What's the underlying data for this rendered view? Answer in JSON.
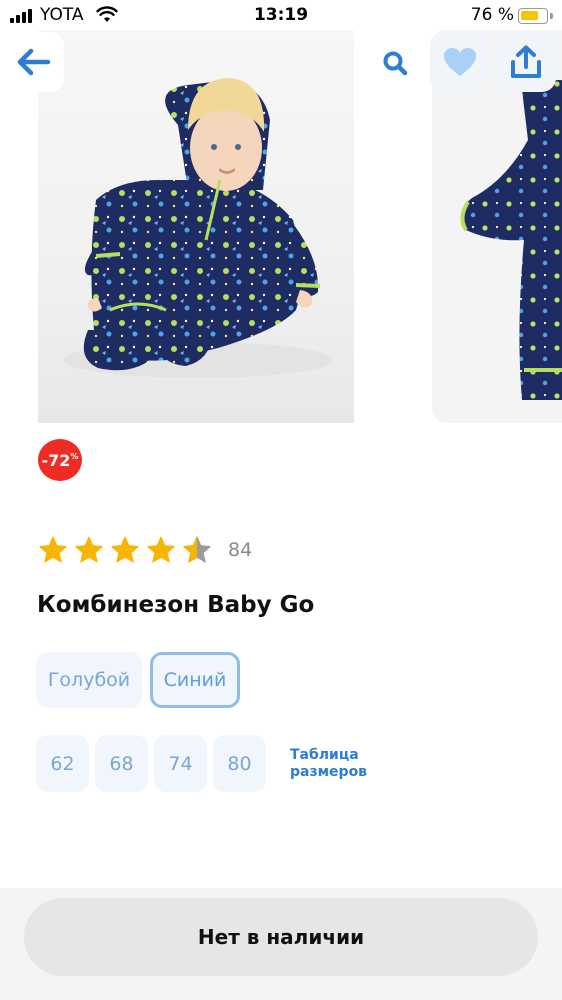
{
  "status_bar": {
    "carrier": "YOTA",
    "time": "13:19",
    "battery_percent": "76 %",
    "battery_level": 0.76
  },
  "gallery": {
    "icons": {
      "back": "arrow-left-icon",
      "search": "search-icon",
      "favorite": "heart-icon",
      "share": "share-icon"
    },
    "photo_count_visible": 2
  },
  "badge": {
    "discount_value": "-72",
    "discount_unit": "%"
  },
  "rating": {
    "stars": 4.5,
    "max_stars": 5,
    "review_count": "84"
  },
  "product": {
    "title": "Комбинезон Baby Go"
  },
  "colors": {
    "options": [
      "Голубой",
      "Синий"
    ],
    "selected": "Синий"
  },
  "sizes": {
    "options": [
      "62",
      "68",
      "74",
      "80"
    ],
    "size_table_line1": "Таблица",
    "size_table_line2": "размеров"
  },
  "cta": {
    "label": "Нет в наличии"
  },
  "theme": {
    "accent": "#2d7dd3",
    "discount_red": "#ee2b24",
    "star_yellow": "#f7b500",
    "chip_bg": "#f1f6fc"
  }
}
